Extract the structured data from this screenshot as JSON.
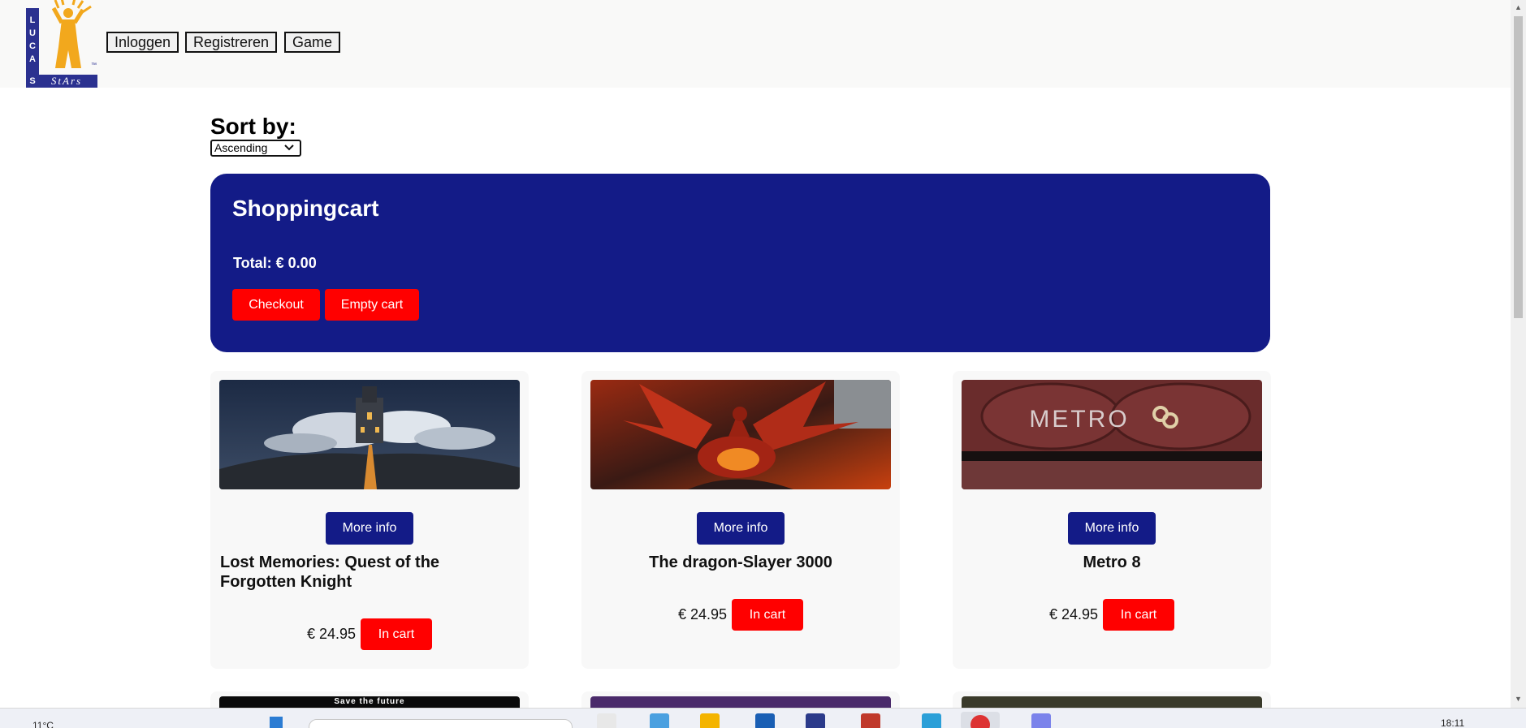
{
  "logo": {
    "letters": [
      "L",
      "U",
      "C",
      "A",
      "S"
    ],
    "tagline": "StArs",
    "tm": "™"
  },
  "nav": {
    "login": "Inloggen",
    "register": "Registreren",
    "game": "Game"
  },
  "sort": {
    "label": "Sort by:",
    "selected": "Ascending"
  },
  "cart": {
    "title": "Shoppingcart",
    "total": "Total: € 0.00",
    "checkout": "Checkout",
    "empty": "Empty cart"
  },
  "products": [
    {
      "title": "Lost Memories: Quest of the Forgotten Knight",
      "price": "€ 24.95",
      "more": "More info",
      "cart": "In cart"
    },
    {
      "title": "The dragon-Slayer 3000",
      "price": "€ 24.95",
      "more": "More info",
      "cart": "In cart"
    },
    {
      "title": "Metro 8",
      "price": "€ 24.95",
      "more": "More info",
      "cart": "In cart",
      "image_text": "METRO"
    }
  ],
  "next_row": {
    "banner_text": "Save the future"
  },
  "taskbar": {
    "weather": "11°C",
    "clock": "18:11"
  },
  "colors": {
    "primary": "#131b87",
    "danger": "#ff0000",
    "logo_blue": "#2b3190",
    "logo_gold": "#f2a81d"
  }
}
